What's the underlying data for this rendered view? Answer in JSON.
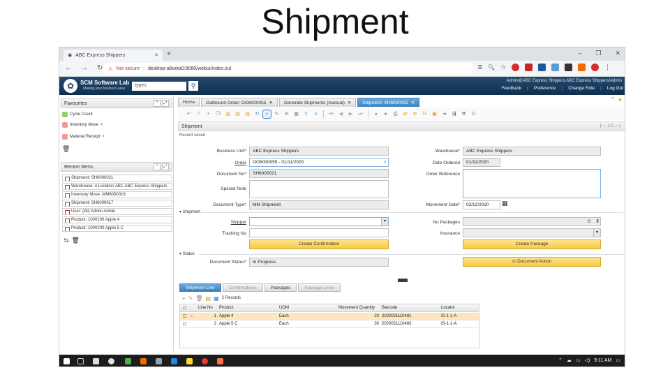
{
  "slide": {
    "title": "Shipment"
  },
  "browser": {
    "tab_title": "ABC Express Shippers",
    "security_label": "Not secure",
    "url": "desktop-a8veta0:8080/webui/index.zul"
  },
  "header": {
    "brand": "SCM Software Lab",
    "tagline": "Making your business easy",
    "search_value": "types",
    "user": "Admin@ABC Express Shippers.ABC Express Shippers/Admin",
    "links": [
      "Feedback",
      "Preference",
      "Change Role",
      "Log Out"
    ]
  },
  "favourites": {
    "title": "Favourites",
    "items": [
      "Cycle Count",
      "Inventory Move",
      "Material Receipt"
    ]
  },
  "recent": {
    "title": "Recent Items",
    "items": [
      "Shipment: SH6000021",
      "Warehouse: A Location ABC ABC Express Shippers",
      "Inventory Move: MM6000016",
      "Shipment: SH6000017",
      "User: (All) Admin Admin",
      "Product: 1000100 Apple 4",
      "Product: 1000200 Apple 5 C"
    ]
  },
  "window_tabs": [
    {
      "label": "Home",
      "active": false
    },
    {
      "label": "Outbound Order: OO6000055",
      "active": false
    },
    {
      "label": "Generate Shipments (manual)",
      "active": false
    },
    {
      "label": "Shipment: SH6000021",
      "active": true
    }
  ],
  "form": {
    "section_title": "Shipment",
    "pager": "1/1",
    "status_message": "Record saved",
    "business_unit": {
      "label": "Business Unit",
      "value": "ABC Express Shippers"
    },
    "order": {
      "label": "Order",
      "value": "OO6000055 - 01/11/2020"
    },
    "document_no": {
      "label": "Document No",
      "value": "SH6000021"
    },
    "special_note": {
      "label": "Special Note",
      "value": ""
    },
    "document_type": {
      "label": "Document Type",
      "value": "MM Shipment"
    },
    "warehouse": {
      "label": "Warehouse",
      "value": "ABC Express Shippers"
    },
    "date_ordered": {
      "label": "Date Ordered",
      "value": "01/11/2020"
    },
    "order_reference": {
      "label": "Order Reference",
      "value": ""
    },
    "movement_date": {
      "label": "Movement Date",
      "value": "02/12/2020"
    },
    "shipment_group": "Shipment",
    "shipper": {
      "label": "Shipper",
      "value": ""
    },
    "tracking_no": {
      "label": "Tracking No",
      "value": ""
    },
    "no_packages": {
      "label": "No Packages",
      "value": "0"
    },
    "insurance": {
      "label": "Insurance",
      "value": ""
    },
    "create_confirmation": "Create Confirmation",
    "create_package": "Create Package",
    "status_group": "Status",
    "document_status": {
      "label": "Document Status",
      "value": "In Progress"
    },
    "document_action": "Document Action"
  },
  "detail": {
    "tabs": [
      {
        "label": "Shipment Line",
        "state": "active"
      },
      {
        "label": "Confirmations",
        "state": "disabled"
      },
      {
        "label": "Packages",
        "state": "normal"
      },
      {
        "label": "Package Lines",
        "state": "disabled"
      }
    ],
    "records_label": "2 Records",
    "columns": [
      "Line No",
      "Product",
      "UOM",
      "Movement Quantity",
      "Barcode",
      "Locator"
    ],
    "rows": [
      {
        "line": "1",
        "product": "Apple 4",
        "uom": "Each",
        "qty": "20",
        "barcode": "2020021110481",
        "locator": "IS-1-1-A"
      },
      {
        "line": "2",
        "product": "Apple 5 C",
        "uom": "Each",
        "qty": "30",
        "barcode": "2020021110483",
        "locator": "IS-1-1-A"
      }
    ]
  },
  "taskbar": {
    "clock": "9:11 AM"
  }
}
